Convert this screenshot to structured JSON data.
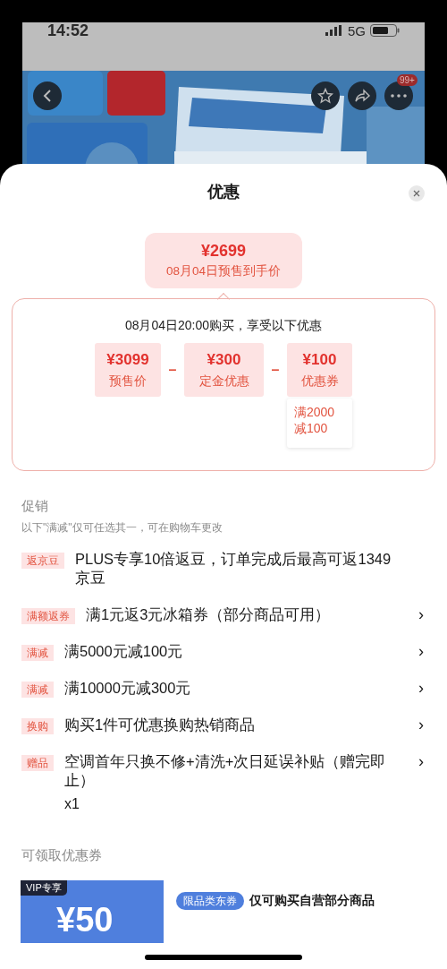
{
  "status_bar": {
    "time": "14:52",
    "network": "5G"
  },
  "banner": {
    "kind": "picture",
    "cart_badge": "99+"
  },
  "sheet": {
    "title": "优惠"
  },
  "final_price": {
    "price": "¥2699",
    "label": "08月04日预售到手价"
  },
  "breakdown": {
    "heading": "08月04日20:00购买，享受以下优惠",
    "items": [
      {
        "amount": "¥3099",
        "label": "预售价"
      },
      {
        "amount": "¥300",
        "label": "定金优惠"
      },
      {
        "amount": "¥100",
        "label": "优惠券",
        "note": "满2000\n减100"
      }
    ],
    "operator": "–"
  },
  "promotions": {
    "title": "促销",
    "note": "以下\"满减\"仅可任选其一，可在购物车更改",
    "items": [
      {
        "tag": "返京豆",
        "text": "PLUS专享10倍返豆，订单完成后最高可返1349京豆",
        "arrow": false
      },
      {
        "tag": "满额返券",
        "text": "满1元返3元冰箱券（部分商品可用）",
        "arrow": true
      },
      {
        "tag": "满减",
        "text": "满5000元减100元",
        "arrow": true
      },
      {
        "tag": "满减",
        "text": "满10000元减300元",
        "arrow": true
      },
      {
        "tag": "换购",
        "text": "购买1件可优惠换购热销商品",
        "arrow": true
      },
      {
        "tag": "赠品",
        "text": "空调首年只换不修+清洗+次日延误补贴（赠完即止）",
        "quantity": "x1",
        "arrow": true
      }
    ]
  },
  "coupons": {
    "title": "可领取优惠券",
    "items": [
      {
        "badge": "VIP专享",
        "amount": "¥50",
        "category": "限品类东券",
        "description": "仅可购买自营部分商品"
      }
    ]
  },
  "arrow_glyph": "›"
}
